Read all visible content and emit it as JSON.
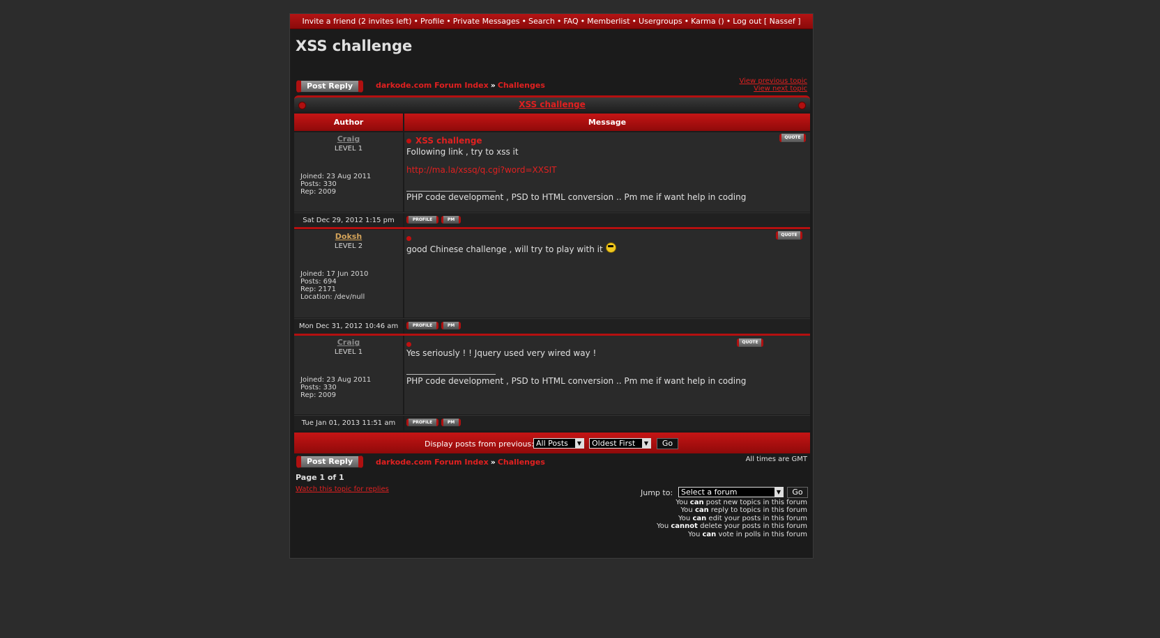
{
  "nav": {
    "items": [
      "Invite a friend (2 invites left)",
      "Profile",
      "Private Messages",
      "Search",
      "FAQ",
      "Memberlist",
      "Usergroups",
      "Karma ()",
      "Log out [ Nassef ]"
    ],
    "separator": "•"
  },
  "page_title": "XSS challenge",
  "post_reply_label": "Post Reply",
  "breadcrumb": {
    "forum_index": "darkode.com Forum Index",
    "arrow": "»",
    "section": "Challenges"
  },
  "topic_nav": {
    "previous": "View previous topic",
    "next": "View next topic"
  },
  "table": {
    "title": "XSS challenge",
    "col_author": "Author",
    "col_message": "Message"
  },
  "buttons": {
    "quote": "QUOTE",
    "profile": "PROFILE",
    "pm": "PM"
  },
  "posts": [
    {
      "author": "Craig",
      "level": "LEVEL 1",
      "joined": "Joined: 23 Aug 2011",
      "posts": "Posts: 330",
      "rep": "Rep: 2009",
      "subject": "XSS challenge",
      "body": "Following link , try to xss it",
      "link": "http://ma.la/xssq/q.cgi?word=XXSIT",
      "signature": "PHP code development , PSD to HTML conversion .. Pm me if want help in coding",
      "date": "Sat Dec 29, 2012 1:15 pm"
    },
    {
      "author": "Doksh",
      "level": "LEVEL 2",
      "joined": "Joined: 17 Jun 2010",
      "posts": "Posts: 694",
      "rep": "Rep: 2171",
      "location": "Location: /dev/null",
      "body": "good Chinese challenge , will try to play with it",
      "date": "Mon Dec 31, 2012 10:46 am"
    },
    {
      "author": "Craig",
      "level": "LEVEL 1",
      "joined": "Joined: 23 Aug 2011",
      "posts": "Posts: 330",
      "rep": "Rep: 2009",
      "body": "Yes seriously ! ! Jquery used very wired way !",
      "signature": "PHP code development , PSD to HTML conversion .. Pm me if want help in coding",
      "date": "Tue Jan 01, 2013 11:51 am"
    }
  ],
  "display_bar": {
    "label": "Display posts from previous:",
    "period_value": "All Posts",
    "order_value": "Oldest First",
    "go": "Go"
  },
  "timezone": "All times are GMT",
  "page_info": "Page 1 of 1",
  "watch_link": "Watch this topic for replies",
  "jump": {
    "label": "Jump to:",
    "value": "Select a forum",
    "go": "Go"
  },
  "permissions": [
    {
      "pre": "You ",
      "word": "can",
      "post": " post new topics in this forum"
    },
    {
      "pre": "You ",
      "word": "can",
      "post": " reply to topics in this forum"
    },
    {
      "pre": "You ",
      "word": "can",
      "post": " edit your posts in this forum"
    },
    {
      "pre": "You ",
      "word": "cannot",
      "post": " delete your posts in this forum"
    },
    {
      "pre": "You ",
      "word": "can",
      "post": " vote in polls in this forum"
    }
  ],
  "colors": {
    "accent": "#c51515",
    "link": "#e02020",
    "background": "#2c2c2c",
    "panel": "#2a2a2a"
  }
}
